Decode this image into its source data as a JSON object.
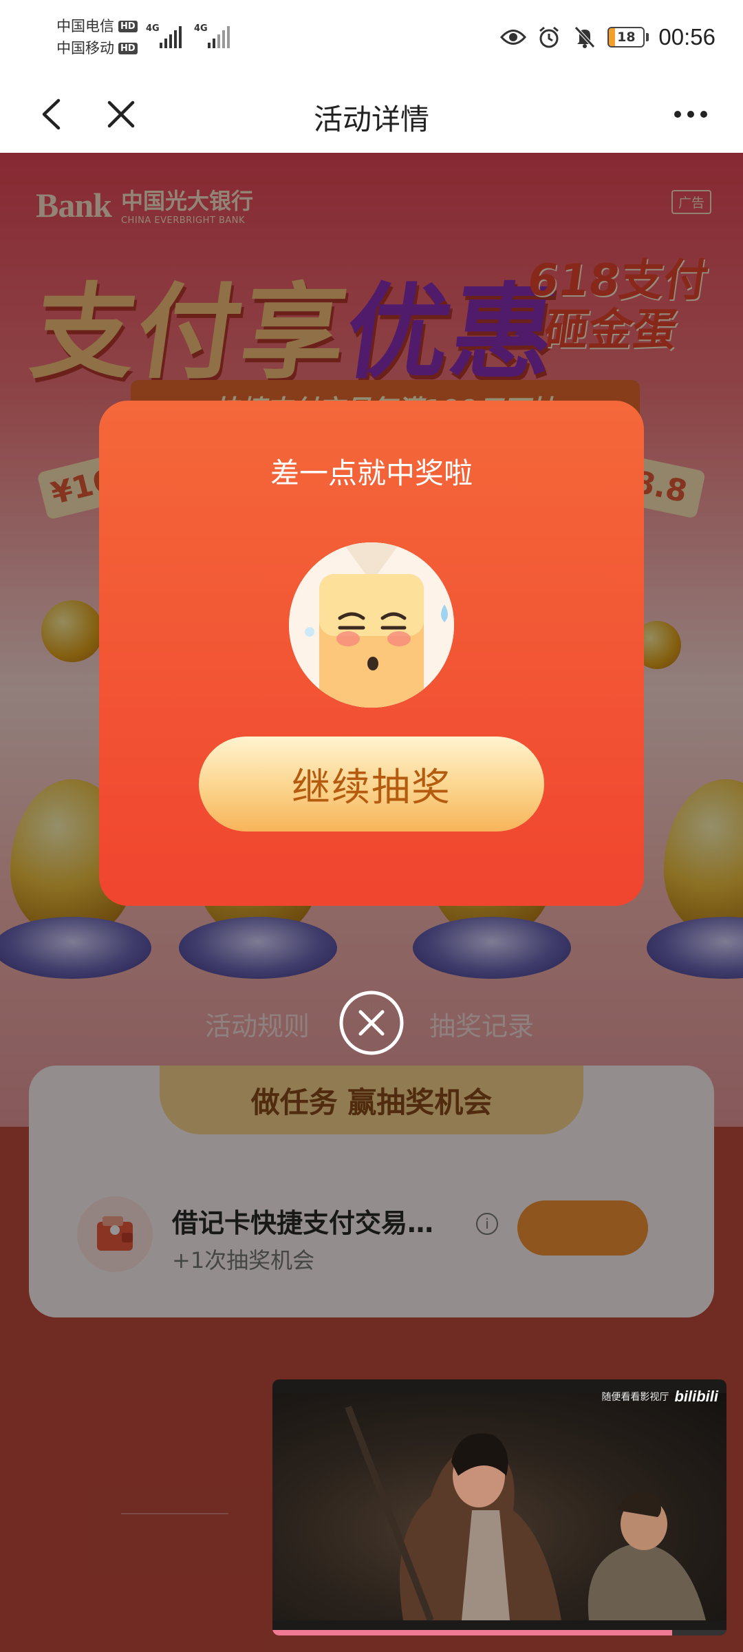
{
  "status_bar": {
    "carrier_1": "中国电信",
    "carrier_2": "中国移动",
    "hd_badge": "HD",
    "network_1": "4G",
    "network_2": "4G",
    "battery_level": "18",
    "battery_fraction": 0.18,
    "time": "00:56",
    "icons": [
      "eye-icon",
      "alarm-icon",
      "bell-muted-icon"
    ]
  },
  "nav": {
    "title": "活动详情",
    "back_icon": "back-chevron-icon",
    "close_icon": "close-icon",
    "more_icon": "more-dots-icon"
  },
  "banner": {
    "bank_logo_mark": "Bank",
    "bank_name": "中国光大银行",
    "bank_name_en": "CHINA EVERBRIGHT BANK",
    "ad_tag": "广告",
    "headline_1": "支付享",
    "headline_2": "优惠",
    "promo_line_1": "618支付",
    "promo_line_2": "砸金蛋",
    "subtitle": "快捷支付交易每满100元可抽",
    "ticket_left": "¥16",
    "ticket_right": "8.8"
  },
  "tabs": {
    "rules": "活动规则",
    "records": "抽奖记录"
  },
  "task_card": {
    "header": "做任务 赢抽奖机会",
    "item_title": "借记卡快捷支付交易…",
    "item_sub": "+1次抽奖机会"
  },
  "modal": {
    "title": "差一点就中奖啦",
    "button": "继续抽奖",
    "avatar": "sad-face-illustration"
  },
  "pip_video": {
    "caption": "随便看看影视厅",
    "logo": "bilibili",
    "progress": 0.88
  },
  "colors": {
    "modal_top": "#f4683a",
    "modal_bottom": "#f0452f",
    "button_text": "#b55b0f"
  }
}
